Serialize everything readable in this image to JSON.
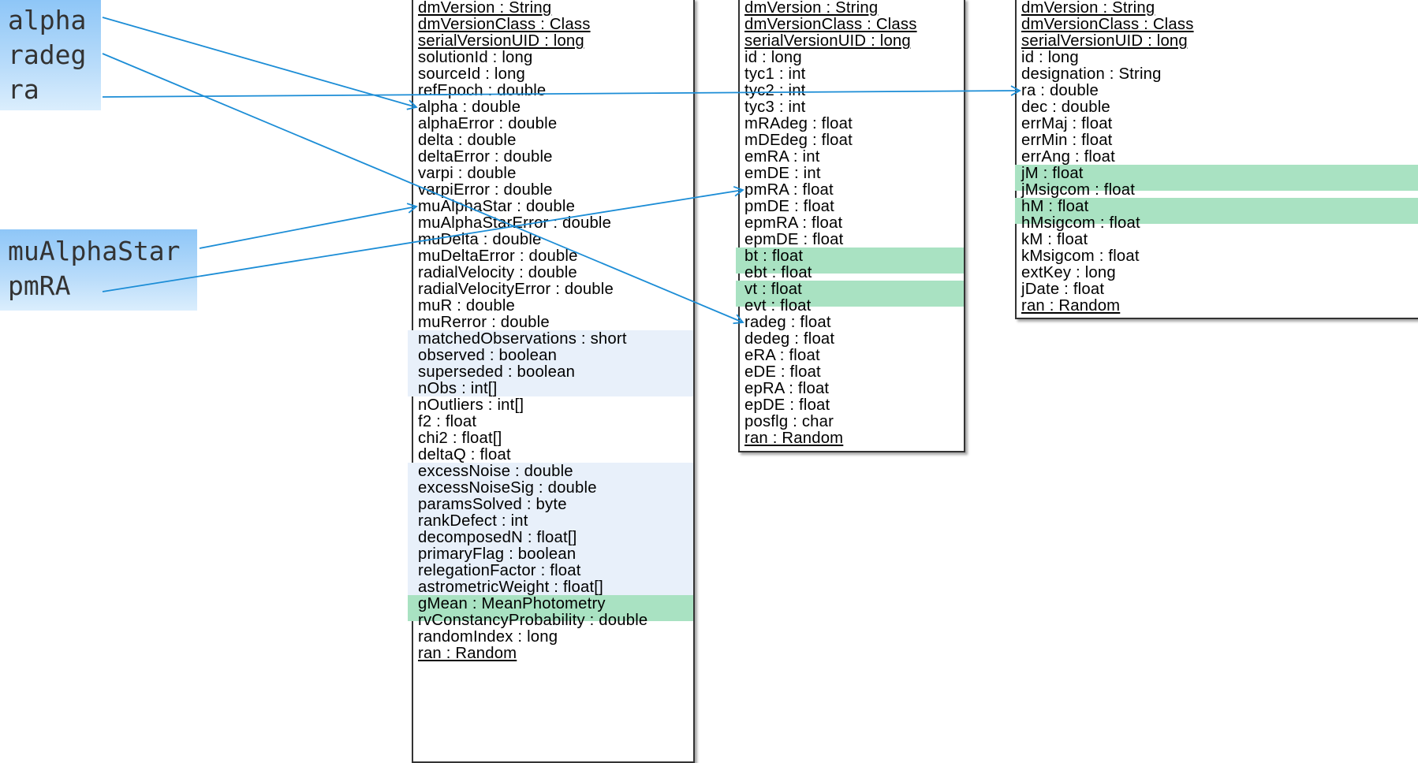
{
  "colors": {
    "arrow": "#1c8dd6",
    "highlight_green": "#a9e2c2",
    "highlight_blue": "#e8f0fa",
    "label_gradient_top": "#8ec6f7"
  },
  "labels": {
    "group1": [
      "alpha",
      "radeg",
      "ra"
    ],
    "group2": [
      "muAlphaStar",
      "pmRA"
    ]
  },
  "boxes": {
    "gaia": {
      "attributes": [
        {
          "text": "dmVersion : String",
          "static": true
        },
        {
          "text": "dmVersionClass : Class",
          "static": true
        },
        {
          "text": "serialVersionUID : long",
          "static": true
        },
        {
          "text": "solutionId : long"
        },
        {
          "text": "sourceId : long"
        },
        {
          "text": "refEpoch : double"
        },
        {
          "text": "alpha : double"
        },
        {
          "text": "alphaError : double"
        },
        {
          "text": "delta : double"
        },
        {
          "text": "deltaError : double"
        },
        {
          "text": "varpi : double"
        },
        {
          "text": "varpiError : double"
        },
        {
          "text": "muAlphaStar : double"
        },
        {
          "text": "muAlphaStarError : double"
        },
        {
          "text": "muDelta : double"
        },
        {
          "text": "muDeltaError : double"
        },
        {
          "text": "radialVelocity : double"
        },
        {
          "text": "radialVelocityError : double"
        },
        {
          "text": "muR : double"
        },
        {
          "text": "muRerror : double"
        },
        {
          "text": "matchedObservations : short"
        },
        {
          "text": "observed : boolean"
        },
        {
          "text": "superseded : boolean"
        },
        {
          "text": "nObs : int[]"
        },
        {
          "text": "nOutliers : int[]"
        },
        {
          "text": "f2 : float"
        },
        {
          "text": "chi2 : float[]"
        },
        {
          "text": "deltaQ : float"
        },
        {
          "text": "excessNoise : double"
        },
        {
          "text": "excessNoiseSig : double"
        },
        {
          "text": "paramsSolved : byte"
        },
        {
          "text": "rankDefect : int"
        },
        {
          "text": "decomposedN : float[]"
        },
        {
          "text": "primaryFlag : boolean"
        },
        {
          "text": "relegationFactor : float"
        },
        {
          "text": "astrometricWeight : float[]"
        },
        {
          "text": "gMean : MeanPhotometry"
        },
        {
          "text": "rvConstancyProbability : double"
        },
        {
          "text": "randomIndex : long"
        },
        {
          "text": "ran : Random",
          "static": true
        }
      ],
      "highlights": [
        {
          "from": 20,
          "to": 23,
          "color": "blue"
        },
        {
          "from": 28,
          "to": 35,
          "color": "blue"
        },
        {
          "from": 36,
          "to": 36,
          "color": "green"
        }
      ]
    },
    "tycho": {
      "attributes": [
        {
          "text": "dmVersion : String",
          "static": true
        },
        {
          "text": "dmVersionClass : Class",
          "static": true
        },
        {
          "text": "serialVersionUID : long",
          "static": true
        },
        {
          "text": "id : long"
        },
        {
          "text": "tyc1 : int"
        },
        {
          "text": "tyc2 : int"
        },
        {
          "text": "tyc3 : int"
        },
        {
          "text": "mRAdeg : float"
        },
        {
          "text": "mDEdeg : float"
        },
        {
          "text": "emRA : int"
        },
        {
          "text": "emDE : int"
        },
        {
          "text": "pmRA : float"
        },
        {
          "text": "pmDE : float"
        },
        {
          "text": "epmRA : float"
        },
        {
          "text": "epmDE : float"
        },
        {
          "text": "bt : float"
        },
        {
          "text": "ebt : float"
        },
        {
          "text": "vt : float"
        },
        {
          "text": "evt : float"
        },
        {
          "text": "radeg : float"
        },
        {
          "text": "dedeg : float"
        },
        {
          "text": "eRA : float"
        },
        {
          "text": "eDE : float"
        },
        {
          "text": "epRA : float"
        },
        {
          "text": "epDE : float"
        },
        {
          "text": "posflg : char"
        },
        {
          "text": "ran : Random",
          "static": true
        }
      ],
      "highlights": [
        {
          "from": 15,
          "to": 15,
          "color": "green"
        },
        {
          "from": 17,
          "to": 17,
          "color": "green"
        }
      ]
    },
    "twomass": {
      "attributes": [
        {
          "text": "dmVersion : String",
          "static": true
        },
        {
          "text": "dmVersionClass : Class",
          "static": true
        },
        {
          "text": "serialVersionUID : long",
          "static": true
        },
        {
          "text": "id : long"
        },
        {
          "text": "designation : String"
        },
        {
          "text": "ra : double"
        },
        {
          "text": "dec : double"
        },
        {
          "text": "errMaj : float"
        },
        {
          "text": "errMin : float"
        },
        {
          "text": "errAng : float"
        },
        {
          "text": "jM : float"
        },
        {
          "text": "jMsigcom : float"
        },
        {
          "text": "hM : float"
        },
        {
          "text": "hMsigcom : float"
        },
        {
          "text": "kM : float"
        },
        {
          "text": "kMsigcom : float"
        },
        {
          "text": "extKey : long"
        },
        {
          "text": "jDate : float"
        },
        {
          "text": "ran : Random",
          "static": true
        }
      ],
      "highlights": [
        {
          "from": 10,
          "to": 10,
          "color": "green"
        },
        {
          "from": 12,
          "to": 12,
          "color": "green"
        }
      ]
    }
  },
  "arrows": [
    {
      "from_label": "alpha",
      "to_box": "gaia",
      "to_attr": "alpha : double"
    },
    {
      "from_label": "radeg",
      "to_box": "tycho",
      "to_attr": "radeg : float"
    },
    {
      "from_label": "ra",
      "to_box": "twomass",
      "to_attr": "ra : double"
    },
    {
      "from_label": "muAlphaStar",
      "to_box": "gaia",
      "to_attr": "muAlphaStar : double"
    },
    {
      "from_label": "pmRA",
      "to_box": "tycho",
      "to_attr": "pmRA : float"
    }
  ]
}
